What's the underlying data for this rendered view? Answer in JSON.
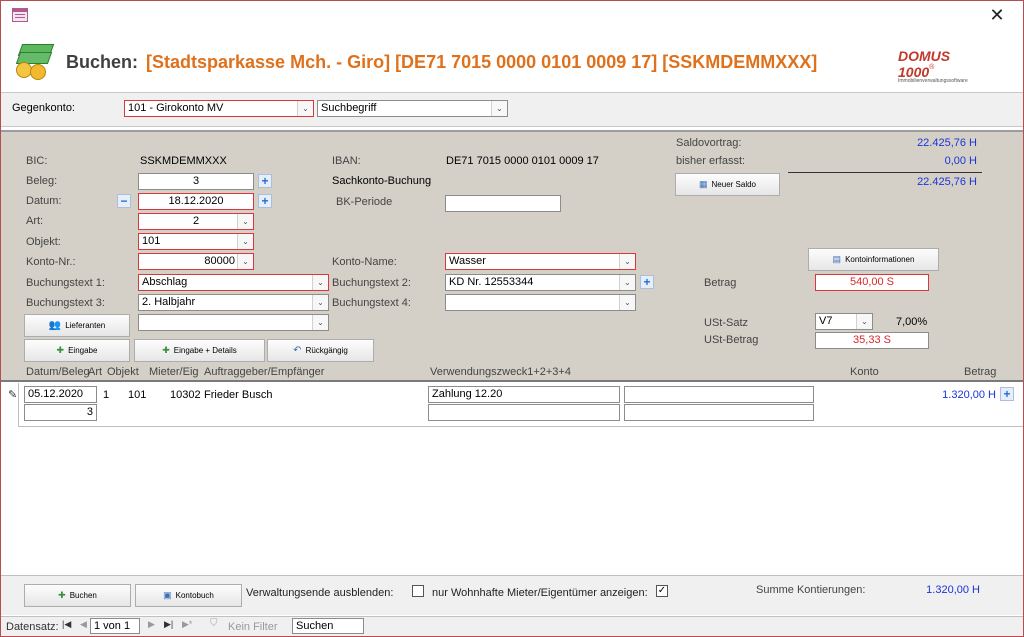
{
  "window": {
    "close_icon": "close-icon",
    "app_icon": "form-icon"
  },
  "header": {
    "prefix": "Buchen:",
    "title": "[Stadtsparkasse Mch. - Giro] [DE71 7015 0000 0101 0009 17] [SSKMDEMMXXX]",
    "logo_main": "DOMUS 1000",
    "logo_sup": "®",
    "logo_sub": "Immobilienverwaltungssoftware"
  },
  "gegenkonto": {
    "label": "Gegenkonto:",
    "value": "101 - Girokonto MV",
    "search": "Suchbegriff"
  },
  "form": {
    "bic_label": "BIC:",
    "bic_value": "SSKMDEMMXXX",
    "iban_label": "IBAN:",
    "iban_value": "DE71 7015 0000 0101 0009 17",
    "beleg_label": "Beleg:",
    "beleg_value": "3",
    "sachkonto": "Sachkonto-Buchung",
    "datum_label": "Datum:",
    "datum_value": "18.12.2020",
    "bk_label": "BK-Periode",
    "bk_value": "",
    "art_label": "Art:",
    "art_value": "2",
    "objekt_label": "Objekt:",
    "objekt_value": "101",
    "konto_nr_label": "Konto-Nr.:",
    "konto_nr_value": "80000",
    "konto_name_label": "Konto-Name:",
    "konto_name_value": "Wasser",
    "bt1_label": "Buchungstext 1:",
    "bt1_value": "Abschlag",
    "bt2_label": "Buchungstext 2:",
    "bt2_value": "KD Nr. 12553344",
    "bt3_label": "Buchungstext 3:",
    "bt3_value": "2. Halbjahr",
    "bt4_label": "Buchungstext 4:",
    "bt4_value": "",
    "lieferanten_value": "",
    "saldovortrag_label": "Saldovortrag:",
    "saldovortrag_value": "22.425,76 H",
    "bisher_label": "bisher erfasst:",
    "bisher_value": "0,00 H",
    "saldo_total": "22.425,76 H",
    "betrag_label": "Betrag",
    "betrag_value": "540,00 S",
    "ust_satz_label": "USt-Satz",
    "ust_satz_value": "V7",
    "ust_pct": "7,00%",
    "ust_betrag_label": "USt-Betrag",
    "ust_betrag_value": "35,33 S"
  },
  "buttons": {
    "neuer_saldo": "Neuer Saldo",
    "kontoinformationen": "Kontoinformationen",
    "lieferanten": "Lieferanten",
    "eingabe": "Eingabe",
    "eingabe_details": "Eingabe + Details",
    "rueckgaengig": "Rückgängig",
    "buchen": "Buchen",
    "kontobuch": "Kontobuch"
  },
  "list": {
    "headers": [
      "Datum/Beleg",
      "Art",
      "Objekt",
      "Mieter/Eig",
      "Auftraggeber/Empfänger",
      "Verwendungszweck1+2+3+4",
      "Konto",
      "Betrag"
    ],
    "row": {
      "datum": "05.12.2020",
      "beleg": "3",
      "art": "1",
      "objekt": "101",
      "mieter": "10302",
      "name": "Frieder Busch",
      "vz1": "Zahlung 12.20",
      "vz2": "",
      "vz3": "",
      "vz4": "",
      "betrag": "1.320,00 H"
    }
  },
  "footer": {
    "verwaltungsende": "Verwaltungsende ausblenden:",
    "nur_wohnhafte": "nur Wohnhafte Mieter/Eigentümer anzeigen:",
    "summe_label": "Summe Kontierungen:",
    "summe_value": "1.320,00 H"
  },
  "nav": {
    "datensatz": "Datensatz:",
    "position": "1 von 1",
    "kein_filter": "Kein Filter",
    "suchen": "Suchen"
  },
  "colors": {
    "accent": "#e0711c",
    "amount_blue": "#1a35d6",
    "amount_red": "#d9272b",
    "panel": "#d4d0c8",
    "border_red": "#d9373b"
  }
}
